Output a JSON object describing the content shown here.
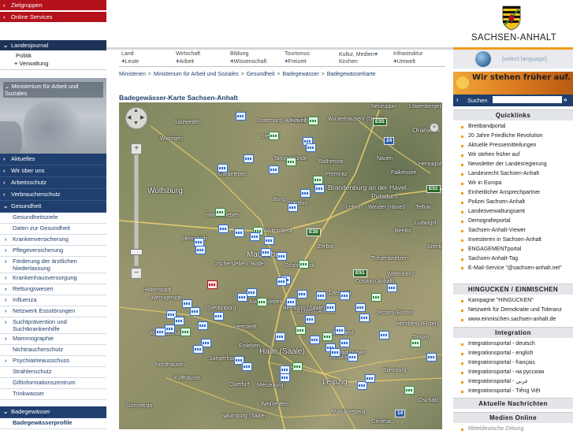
{
  "left": {
    "top_links": [
      {
        "label": "Zielgruppen",
        "color": "#b3121b"
      },
      {
        "label": "Online Services",
        "color": "#b3121b"
      }
    ],
    "landesjournal": {
      "label": "Landesjournal",
      "items": [
        "Politik",
        "Verwaltung"
      ]
    },
    "ministry": "Ministerium für Arbeit und Soziales",
    "nav": [
      "Aktuelles",
      "Wir über uns",
      "Arbeitsschutz",
      "Verbraucherschutz"
    ],
    "open_section": "Gesundheit",
    "subnav": [
      {
        "label": "Gesundheitsziele",
        "arrow": false
      },
      {
        "label": "Daten zur Gesundheit",
        "arrow": false
      },
      {
        "label": "Krankenversicherung",
        "arrow": true
      },
      {
        "label": "Pflegeversicherung",
        "arrow": true
      },
      {
        "label": "Förderung der ärztlichen Niederlassung",
        "arrow": true
      },
      {
        "label": "Krankenhausversorgung",
        "arrow": true
      },
      {
        "label": "Rettungswesen",
        "arrow": true
      },
      {
        "label": "Influenza",
        "arrow": true
      },
      {
        "label": "Netzwerk Essstörungen",
        "arrow": true
      },
      {
        "label": "Suchtprävention und Suchtkrankenhilfe",
        "arrow": true
      },
      {
        "label": "Mammographie",
        "arrow": true
      },
      {
        "label": "Nichtraucherschutz",
        "arrow": false
      },
      {
        "label": "Psychiatrieausschuss",
        "arrow": true
      },
      {
        "label": "Strahlenschutz",
        "arrow": false
      },
      {
        "label": "Giftinformationszentrum",
        "arrow": false
      },
      {
        "label": "Trinkwasser",
        "arrow": false
      }
    ],
    "badegewaesser": "Badegewässer",
    "badegewaesserprofile": "Badegewässerprofile"
  },
  "header": {
    "logo_text": "SACHSEN-ANHALT",
    "lang_label": "[select language]",
    "mainnav": [
      {
        "line1": "Land",
        "line2": "Leute"
      },
      {
        "line1": "Wirtschaft",
        "line2": "Arbeit"
      },
      {
        "line1": "Bildung",
        "line2": "Wissenschaft"
      },
      {
        "line1": "Tourismus",
        "line2": "Freizeit"
      },
      {
        "line1": "Kultur, Medien",
        "line2": "Kirchen"
      },
      {
        "line1": "Infrastruktur",
        "line2": "Umwelt"
      }
    ]
  },
  "breadcrumb": [
    "Ministerien",
    "Ministerium für Arbeit und Soziales",
    "Gesundheit",
    "Badegewässer",
    "Badegewässerkarte"
  ],
  "page_title": "Badegewässer-Karte Sachsen-Anhalt",
  "map": {
    "labels": [
      {
        "text": "Salzwedel",
        "size": "s"
      },
      {
        "text": "Osterburg (Altmark)",
        "size": "s"
      },
      {
        "text": "Havelberg",
        "size": "s"
      },
      {
        "text": "Wusterhausen/ (Dosse)",
        "size": "s"
      },
      {
        "text": "Neuruppin",
        "size": "s"
      },
      {
        "text": "Löwenberger Land",
        "size": "s"
      },
      {
        "text": "Oranienb",
        "size": "m"
      },
      {
        "text": "Wittingen",
        "size": "s"
      },
      {
        "text": "Stendal",
        "size": "s"
      },
      {
        "text": "Tangermünde",
        "size": "s"
      },
      {
        "text": "Rathenow",
        "size": "s"
      },
      {
        "text": "Nauen",
        "size": "s"
      },
      {
        "text": "Hennigsdo",
        "size": "s"
      },
      {
        "text": "Gardelegen",
        "size": "s"
      },
      {
        "text": "Premnitz",
        "size": "s"
      },
      {
        "text": "Falkensee",
        "size": "s"
      },
      {
        "text": "Wolfsburg",
        "size": "b"
      },
      {
        "text": "Brandenburg an der Havel",
        "size": "m"
      },
      {
        "text": "Potsdam",
        "size": "m"
      },
      {
        "text": "Burg",
        "size": "s"
      },
      {
        "text": "Genthin",
        "size": "s"
      },
      {
        "text": "Lehnin",
        "size": "s"
      },
      {
        "text": "Werder (Havel)",
        "size": "s"
      },
      {
        "text": "Teltow",
        "size": "s"
      },
      {
        "text": "Beelitz",
        "size": "s"
      },
      {
        "text": "Ludwigsf",
        "size": "s"
      },
      {
        "text": "Haldensleben",
        "size": "s"
      },
      {
        "text": "Wolmirstedt",
        "size": "s"
      },
      {
        "text": "Helmstedt",
        "size": "s"
      },
      {
        "text": "Magdeburg",
        "size": "b"
      },
      {
        "text": "Schönebeck",
        "size": "s"
      },
      {
        "text": "Oschersleben (Bode)",
        "size": "s"
      },
      {
        "text": "Zerbst",
        "size": "s"
      },
      {
        "text": "Wittenberg",
        "size": "s"
      },
      {
        "text": "Jüterbog",
        "size": "s"
      },
      {
        "text": "Treuenbrietzen",
        "size": "s"
      },
      {
        "text": "Dessau",
        "size": "m"
      },
      {
        "text": "Coswig (Anhalt)",
        "size": "s"
      },
      {
        "text": "Halberstadt",
        "size": "s"
      },
      {
        "text": "Wernigerode",
        "size": "s"
      },
      {
        "text": "Quedlinburg",
        "size": "s"
      },
      {
        "text": "Aschersleben",
        "size": "s"
      },
      {
        "text": "Köthen (Anhalt)",
        "size": "s"
      },
      {
        "text": "Bernburg (Saale)",
        "size": "s"
      },
      {
        "text": "Bitterfeld",
        "size": "s"
      },
      {
        "text": "Jessen (Elster)",
        "size": "s"
      },
      {
        "text": "Herzberg (Elster)",
        "size": "s"
      },
      {
        "text": "Bad Sachsa",
        "size": "s"
      },
      {
        "text": "Hettstedt",
        "size": "s"
      },
      {
        "text": "Eisleben",
        "size": "s"
      },
      {
        "text": "Halle (Saale)",
        "size": "b"
      },
      {
        "text": "Sangerhausen",
        "size": "s"
      },
      {
        "text": "Nordhausen",
        "size": "s"
      },
      {
        "text": "Querfurt",
        "size": "s"
      },
      {
        "text": "Merseburg",
        "size": "s"
      },
      {
        "text": "Leipzig",
        "size": "b"
      },
      {
        "text": "Delitzsch",
        "size": "s"
      },
      {
        "text": "Bad Düben",
        "size": "s"
      },
      {
        "text": "Eilenburg",
        "size": "s"
      },
      {
        "text": "Torgau",
        "size": "s"
      },
      {
        "text": "Naumburg (Saale)",
        "size": "s"
      },
      {
        "text": "Weißenfels",
        "size": "s"
      },
      {
        "text": "Markkleeberg",
        "size": "s"
      },
      {
        "text": "Grimma",
        "size": "s"
      },
      {
        "text": "Oschatz",
        "size": "s"
      },
      {
        "text": "Sömmerda",
        "size": "s"
      },
      {
        "text": "Kyffhäuser",
        "size": "s"
      }
    ],
    "highways": [
      "E55",
      "24",
      "E51",
      "E30",
      "E51",
      "14"
    ]
  },
  "right": {
    "promo": "Wir stehen früher auf.",
    "search_label": "Suchen",
    "quicklinks_title": "Quicklinks",
    "quicklinks": [
      "Breitbandportal",
      "20 Jahre Friedliche Revolution",
      "Aktuelle Pressemitteilungen",
      "Wir stehen früher auf",
      "Newsletter der Landesregierung",
      "Landesrecht Sachsen-Anhalt",
      "Wir in Europa",
      "Einheitlicher Ansprechpartner",
      "Polizei Sachsen-Anhalt",
      "Landesverwaltungsamt",
      "Demografieportal",
      "Sachsen-Anhalt-Viewer",
      "Investieren in Sachsen-Anhalt",
      "ENGAGEMENTportal",
      "Sachsen-Anhalt-Tag",
      "E-Mail-Service \"@sachsen-anhalt.net\""
    ],
    "hingucken_title": "HINGUCKEN / EINMISCHEN",
    "hingucken": [
      "Kampagne \"HINGUCKEN\"",
      "Netzwerk für Demokratie und Toleranz",
      "www.einmischen.sachsen-anhalt.de"
    ],
    "integration_title": "Integration",
    "integration": [
      "Integrationsportal - deutsch",
      "Integrationsportal - english",
      "Integrationsportal - français",
      "Integrationsportal - на русском",
      "Integrationsportal - عربي",
      "Integrationsportal - Tiếng Việt"
    ],
    "news_title": "Aktuelle Nachrichten",
    "media_title": "Medien Online",
    "media_item": "Mitteldeutsche Zeitung"
  },
  "colors": {
    "brand_red": "#b3121b",
    "brand_blue": "#1f3f6e",
    "accent_orange": "#f29d18"
  }
}
